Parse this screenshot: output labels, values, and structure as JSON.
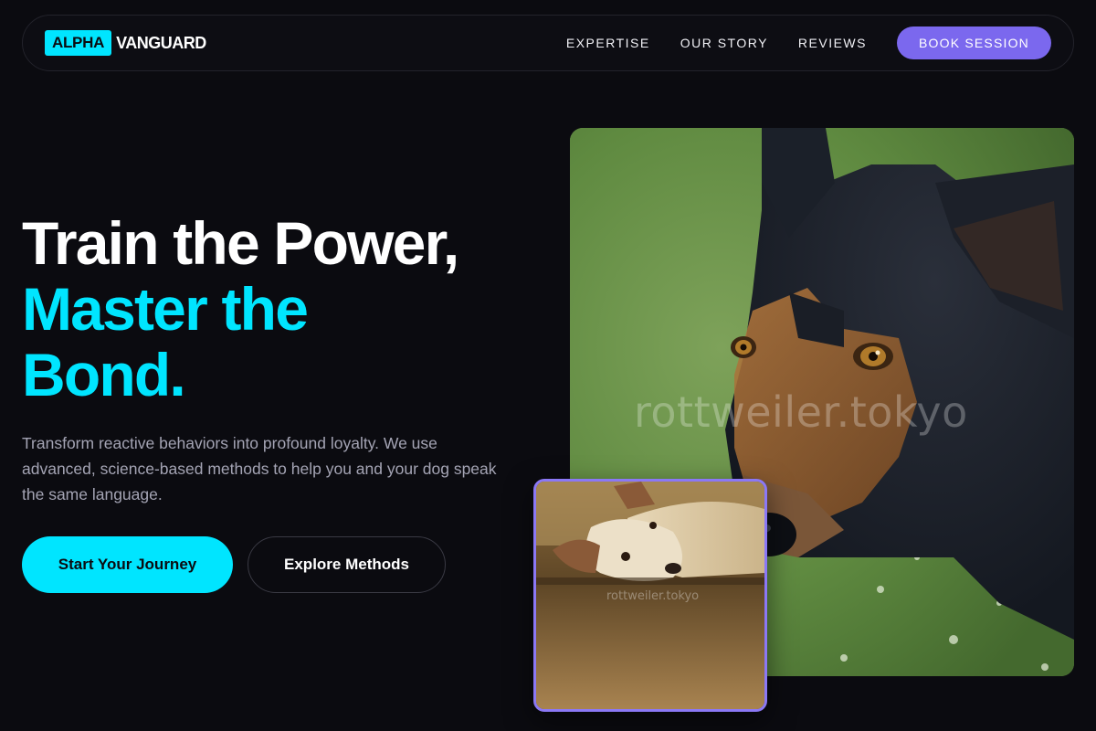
{
  "brand": {
    "logo_box": "ALPHA",
    "logo_text": "VANGUARD"
  },
  "nav": {
    "links": [
      "EXPERTISE",
      "OUR STORY",
      "REVIEWS"
    ],
    "cta": "BOOK SESSION"
  },
  "hero": {
    "headline_line1": "Train the Power,",
    "headline_line2": "Master the",
    "headline_line3": "Bond.",
    "subtext": "Transform reactive behaviors into profound loyalty. We use advanced, science-based methods to help you and your dog speak the same language.",
    "primary_button": "Start Your Journey",
    "secondary_button": "Explore Methods"
  },
  "images": {
    "main_watermark": "rottweiler.tokyo",
    "inset_watermark": "rottweiler.tokyo"
  },
  "colors": {
    "background": "#0b0b10",
    "accent_cyan": "#00e5ff",
    "accent_purple": "#7b68ee",
    "muted_text": "#a4a4b4"
  }
}
